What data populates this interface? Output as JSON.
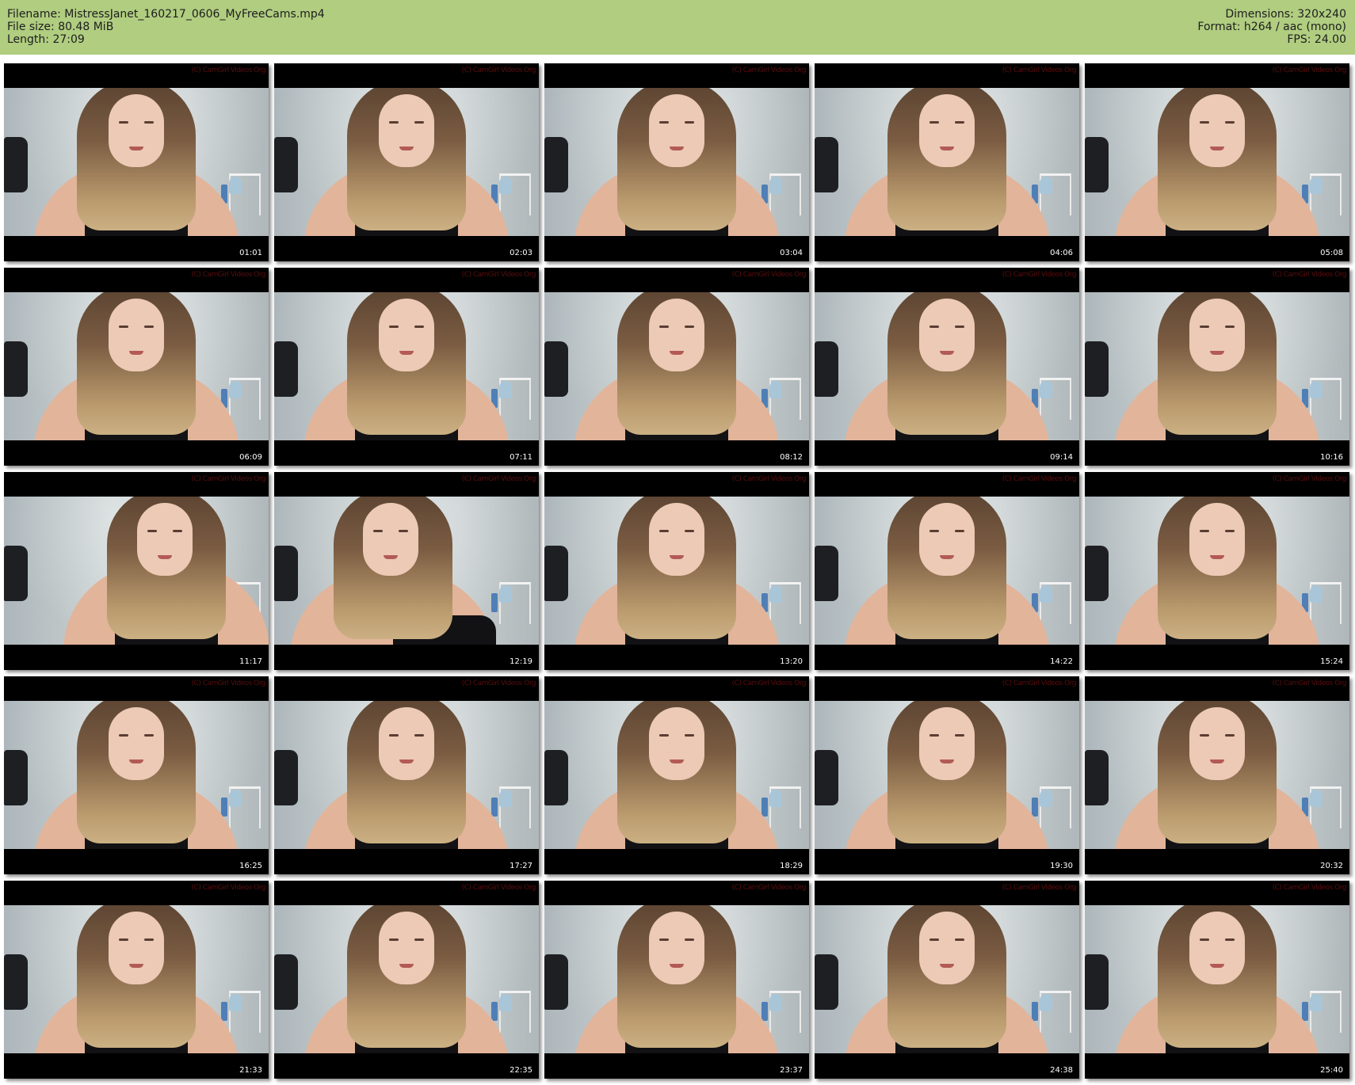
{
  "header": {
    "filename_line": "Filename: MistressJanet_160217_0606_MyFreeCams.mp4",
    "filesize_line": "File size: 80.48 MiB",
    "length_line": "Length: 27:09",
    "dimensions_line": "Dimensions: 320x240",
    "format_line": "Format: h264 / aac (mono)",
    "fps_line": "FPS: 24.00",
    "background_color": "#b0cd80"
  },
  "watermark_text": "(C) CamGirl Videos Org",
  "thumbnails": [
    {
      "timestamp": "01:01",
      "pose": "center-smile"
    },
    {
      "timestamp": "02:03",
      "pose": "center-smile"
    },
    {
      "timestamp": "03:04",
      "pose": "center-smile"
    },
    {
      "timestamp": "04:06",
      "pose": "center"
    },
    {
      "timestamp": "05:08",
      "pose": "center"
    },
    {
      "timestamp": "06:09",
      "pose": "center"
    },
    {
      "timestamp": "07:11",
      "pose": "center"
    },
    {
      "timestamp": "08:12",
      "pose": "center"
    },
    {
      "timestamp": "09:14",
      "pose": "center"
    },
    {
      "timestamp": "10:16",
      "pose": "center"
    },
    {
      "timestamp": "11:17",
      "pose": "lean-close"
    },
    {
      "timestamp": "12:19",
      "pose": "lean-left"
    },
    {
      "timestamp": "13:20",
      "pose": "center"
    },
    {
      "timestamp": "14:22",
      "pose": "center"
    },
    {
      "timestamp": "15:24",
      "pose": "center"
    },
    {
      "timestamp": "16:25",
      "pose": "center-lower"
    },
    {
      "timestamp": "17:27",
      "pose": "center-lower"
    },
    {
      "timestamp": "18:29",
      "pose": "center-lower"
    },
    {
      "timestamp": "19:30",
      "pose": "center-lower"
    },
    {
      "timestamp": "20:32",
      "pose": "center"
    },
    {
      "timestamp": "21:33",
      "pose": "center-lower"
    },
    {
      "timestamp": "22:35",
      "pose": "center-lower"
    },
    {
      "timestamp": "23:37",
      "pose": "center-lower"
    },
    {
      "timestamp": "24:38",
      "pose": "center-lower"
    },
    {
      "timestamp": "25:40",
      "pose": "center-lower"
    }
  ]
}
